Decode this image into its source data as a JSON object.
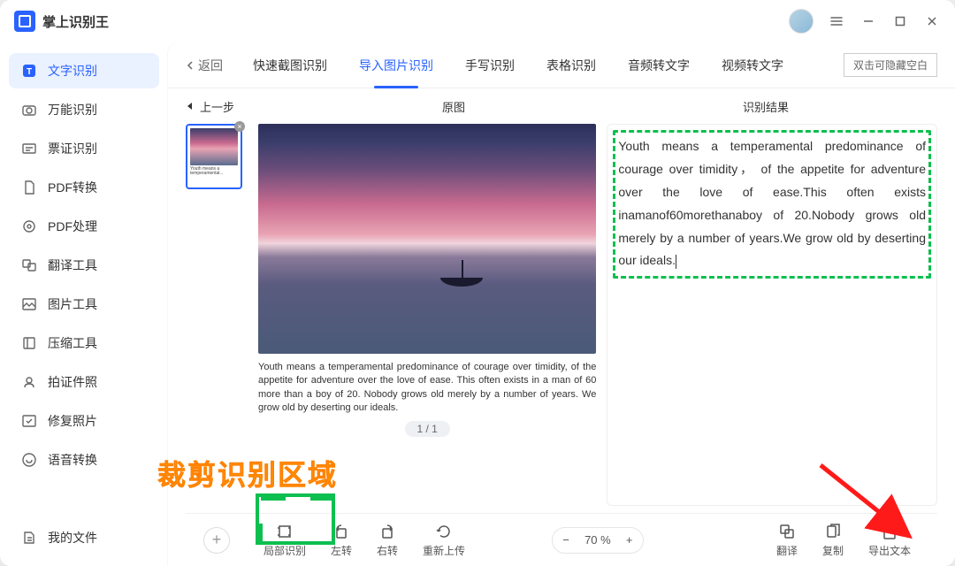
{
  "app": {
    "title": "掌上识别王"
  },
  "sidebar": {
    "items": [
      {
        "label": "文字识别",
        "icon": "text-icon"
      },
      {
        "label": "万能识别",
        "icon": "camera-icon"
      },
      {
        "label": "票证识别",
        "icon": "ticket-icon"
      },
      {
        "label": "PDF转换",
        "icon": "pdf-convert-icon"
      },
      {
        "label": "PDF处理",
        "icon": "pdf-process-icon"
      },
      {
        "label": "翻译工具",
        "icon": "translate-icon"
      },
      {
        "label": "图片工具",
        "icon": "image-icon"
      },
      {
        "label": "压缩工具",
        "icon": "compress-icon"
      },
      {
        "label": "拍证件照",
        "icon": "id-photo-icon"
      },
      {
        "label": "修复照片",
        "icon": "repair-icon"
      },
      {
        "label": "语音转换",
        "icon": "voice-icon"
      }
    ],
    "files": "我的文件"
  },
  "tabs": {
    "back": "返回",
    "items": [
      "快速截图识别",
      "导入图片识别",
      "手写识别",
      "表格识别",
      "音频转文字",
      "视频转文字"
    ],
    "hint": "双击可隐藏空白"
  },
  "subheader": {
    "prev": "上一步",
    "original": "原图",
    "result": "识别结果"
  },
  "preview": {
    "caption": "Youth means a temperamental predominance of courage over timidity, of the appetite for adventure over the love of ease. This often exists in a man of 60 more than a boy of 20. Nobody grows old merely by a number of years. We grow old by deserting our ideals.",
    "pager": "1 / 1"
  },
  "result": {
    "text": "Youth means a temperamental predominance of courage over timidity， of the appetite for adventure over the love of ease.This often exists inamanof60morethanaboy of 20.Nobody grows old merely by a number of years.We grow old by deserting our ideals."
  },
  "toolbar": {
    "crop": "局部识别",
    "rotate_left": "左转",
    "rotate_right": "右转",
    "reupload": "重新上传",
    "zoom": "70 %",
    "translate": "翻译",
    "copy": "复制",
    "export": "导出文本"
  },
  "annotation": {
    "text": "裁剪识别区域"
  }
}
